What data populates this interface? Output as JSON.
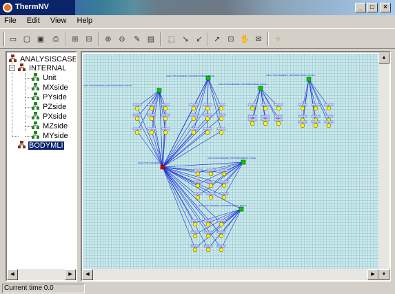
{
  "window": {
    "title": "ThermNV",
    "buttons": {
      "minimize": "_",
      "maximize": "□",
      "close": "×"
    }
  },
  "menu": [
    "File",
    "Edit",
    "View",
    "Help"
  ],
  "toolbar_icons": [
    "new-icon",
    "open-icon",
    "save-icon",
    "print-icon",
    "grid-icon",
    "layout-icon",
    "zoom-in-icon",
    "zoom-out-icon",
    "edit-icon",
    "properties-icon",
    "select-region-icon",
    "link-icon",
    "unlink-icon",
    "pointer-icon",
    "fit-icon",
    "pan-icon",
    "comment-icon",
    "network-icon"
  ],
  "tree": {
    "root": "ANALYSISCASEDE",
    "group": "INTERNAL",
    "children": [
      "Unit",
      "MXside",
      "PYside",
      "PZside",
      "PXside",
      "MZside",
      "MYside"
    ],
    "selected": "BODYMLI"
  },
  "diagram": {
    "center_label": "ANALYSISCASEDEMO_WINTER",
    "hub_labels": [
      "ANALYSISCASEDEMO_WINTERINTERNAL.PYside",
      "ANALYSISCASEDEMO_WINTERINTERNAL.MXside",
      "ANALYSISCASEDEMO_WINTERINTERNAL.PZside",
      "ANALYSISCASEDEMO_WINTERINTERNAL.MYside",
      "ANALYSISCASEDEMO_WINTERINTERNAL.PXside",
      "ANALYSISCASEDEMO_WINTERINTERNAL.MZside"
    ],
    "leaf_label": "CONDUC",
    "colors": {
      "leaf": "#ffff00",
      "hub": "#00cc00",
      "center": "#d00000",
      "edge": "#1a2fd8"
    }
  },
  "status": {
    "text": "Current time 0.0"
  },
  "colors": {
    "titlebar": "#0a246a",
    "selection": "#0a246a",
    "face": "#d4d0c8"
  }
}
